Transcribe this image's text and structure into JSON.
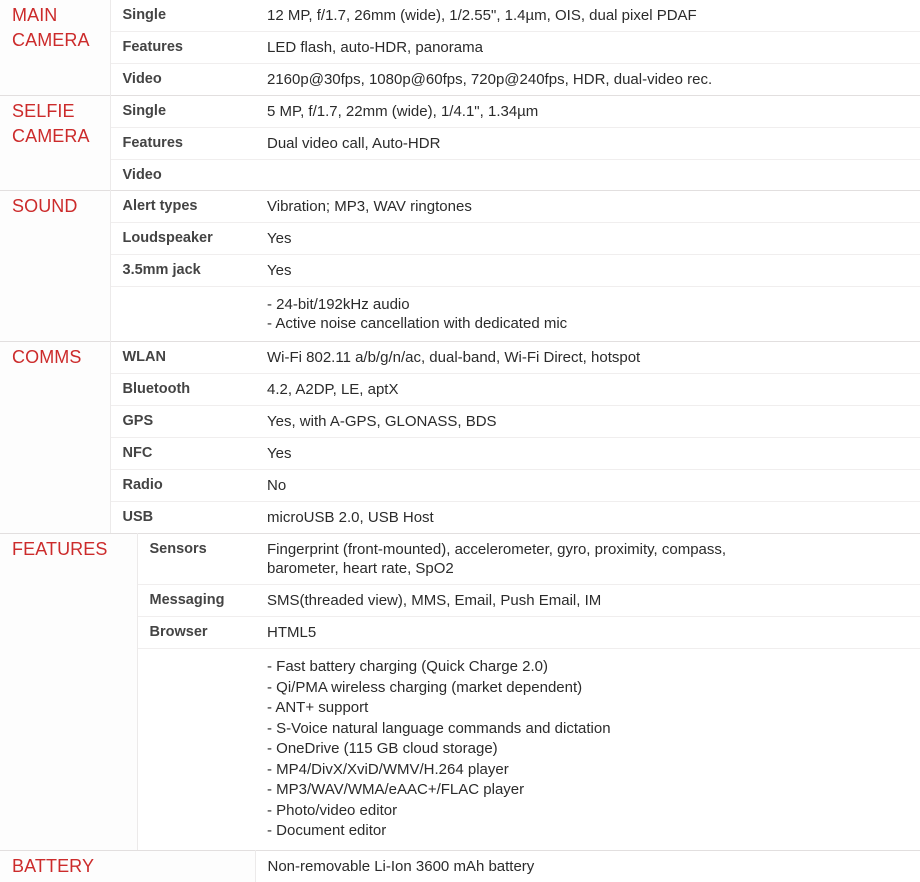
{
  "colors": {
    "section_heading": "#cc2b2b",
    "label_text": "#444444",
    "value_text": "#2b2b2b",
    "row_divider": "#f0eeee",
    "section_divider": "#e2dfdf"
  },
  "sections": [
    {
      "id": "main-camera",
      "heading_lines": [
        "MAIN",
        "CAMERA"
      ],
      "heading": "MAIN CAMERA",
      "rows": [
        {
          "label": "Single",
          "value": "12 MP, f/1.7, 26mm (wide), 1/2.55\", 1.4µm, OIS, dual pixel PDAF"
        },
        {
          "label": "Features",
          "value": "LED flash, auto-HDR, panorama"
        },
        {
          "label": "Video",
          "value": "2160p@30fps, 1080p@60fps, 720p@240fps, HDR, dual-video rec."
        }
      ]
    },
    {
      "id": "selfie-camera",
      "heading_lines": [
        "SELFIE",
        "CAMERA"
      ],
      "heading": "SELFIE CAMERA",
      "rows": [
        {
          "label": "Single",
          "value": "5 MP, f/1.7, 22mm (wide), 1/4.1\", 1.34µm"
        },
        {
          "label": "Features",
          "value": "Dual video call, Auto-HDR"
        },
        {
          "label": "Video",
          "value": ""
        }
      ]
    },
    {
      "id": "sound",
      "heading_lines": [
        "SOUND"
      ],
      "heading": "SOUND",
      "rows": [
        {
          "label": "Alert types",
          "value": "Vibration; MP3, WAV ringtones"
        },
        {
          "label": "Loudspeaker",
          "value": "Yes"
        },
        {
          "label": "3.5mm jack",
          "value": "Yes"
        },
        {
          "label": "",
          "value": "- 24-bit/192kHz audio\n- Active noise cancellation with dedicated mic"
        }
      ]
    },
    {
      "id": "comms",
      "heading_lines": [
        "COMMS"
      ],
      "heading": "COMMS",
      "rows": [
        {
          "label": "WLAN",
          "value": "Wi-Fi 802.11 a/b/g/n/ac, dual-band, Wi-Fi Direct, hotspot"
        },
        {
          "label": "Bluetooth",
          "value": "4.2, A2DP, LE, aptX"
        },
        {
          "label": "GPS",
          "value": "Yes, with A-GPS, GLONASS, BDS"
        },
        {
          "label": "NFC",
          "value": "Yes"
        },
        {
          "label": "Radio",
          "value": "No"
        },
        {
          "label": "USB",
          "value": "microUSB 2.0, USB Host"
        }
      ]
    },
    {
      "id": "features",
      "heading_lines": [
        "FEATURES"
      ],
      "heading": "FEATURES",
      "rows": [
        {
          "label": "Sensors",
          "value": "Fingerprint (front-mounted), accelerometer, gyro, proximity, compass,\nbarometer, heart rate, SpO2"
        },
        {
          "label": "Messaging",
          "value": "SMS(threaded view), MMS, Email, Push Email, IM"
        },
        {
          "label": "Browser",
          "value": "HTML5"
        }
      ],
      "bullets": [
        "- Fast battery charging (Quick Charge 2.0)",
        "- Qi/PMA wireless charging (market dependent)",
        "- ANT+ support",
        "- S-Voice natural language commands and dictation",
        "- OneDrive (115 GB cloud storage)",
        "- MP4/DivX/XviD/WMV/H.264 player",
        "- MP3/WAV/WMA/eAAC+/FLAC player",
        "- Photo/video editor",
        "- Document editor"
      ]
    },
    {
      "id": "battery",
      "heading_lines": [
        "BATTERY"
      ],
      "heading": "BATTERY",
      "rows": [
        {
          "label": "",
          "value": "Non-removable Li-Ion 3600 mAh battery"
        }
      ]
    }
  ]
}
